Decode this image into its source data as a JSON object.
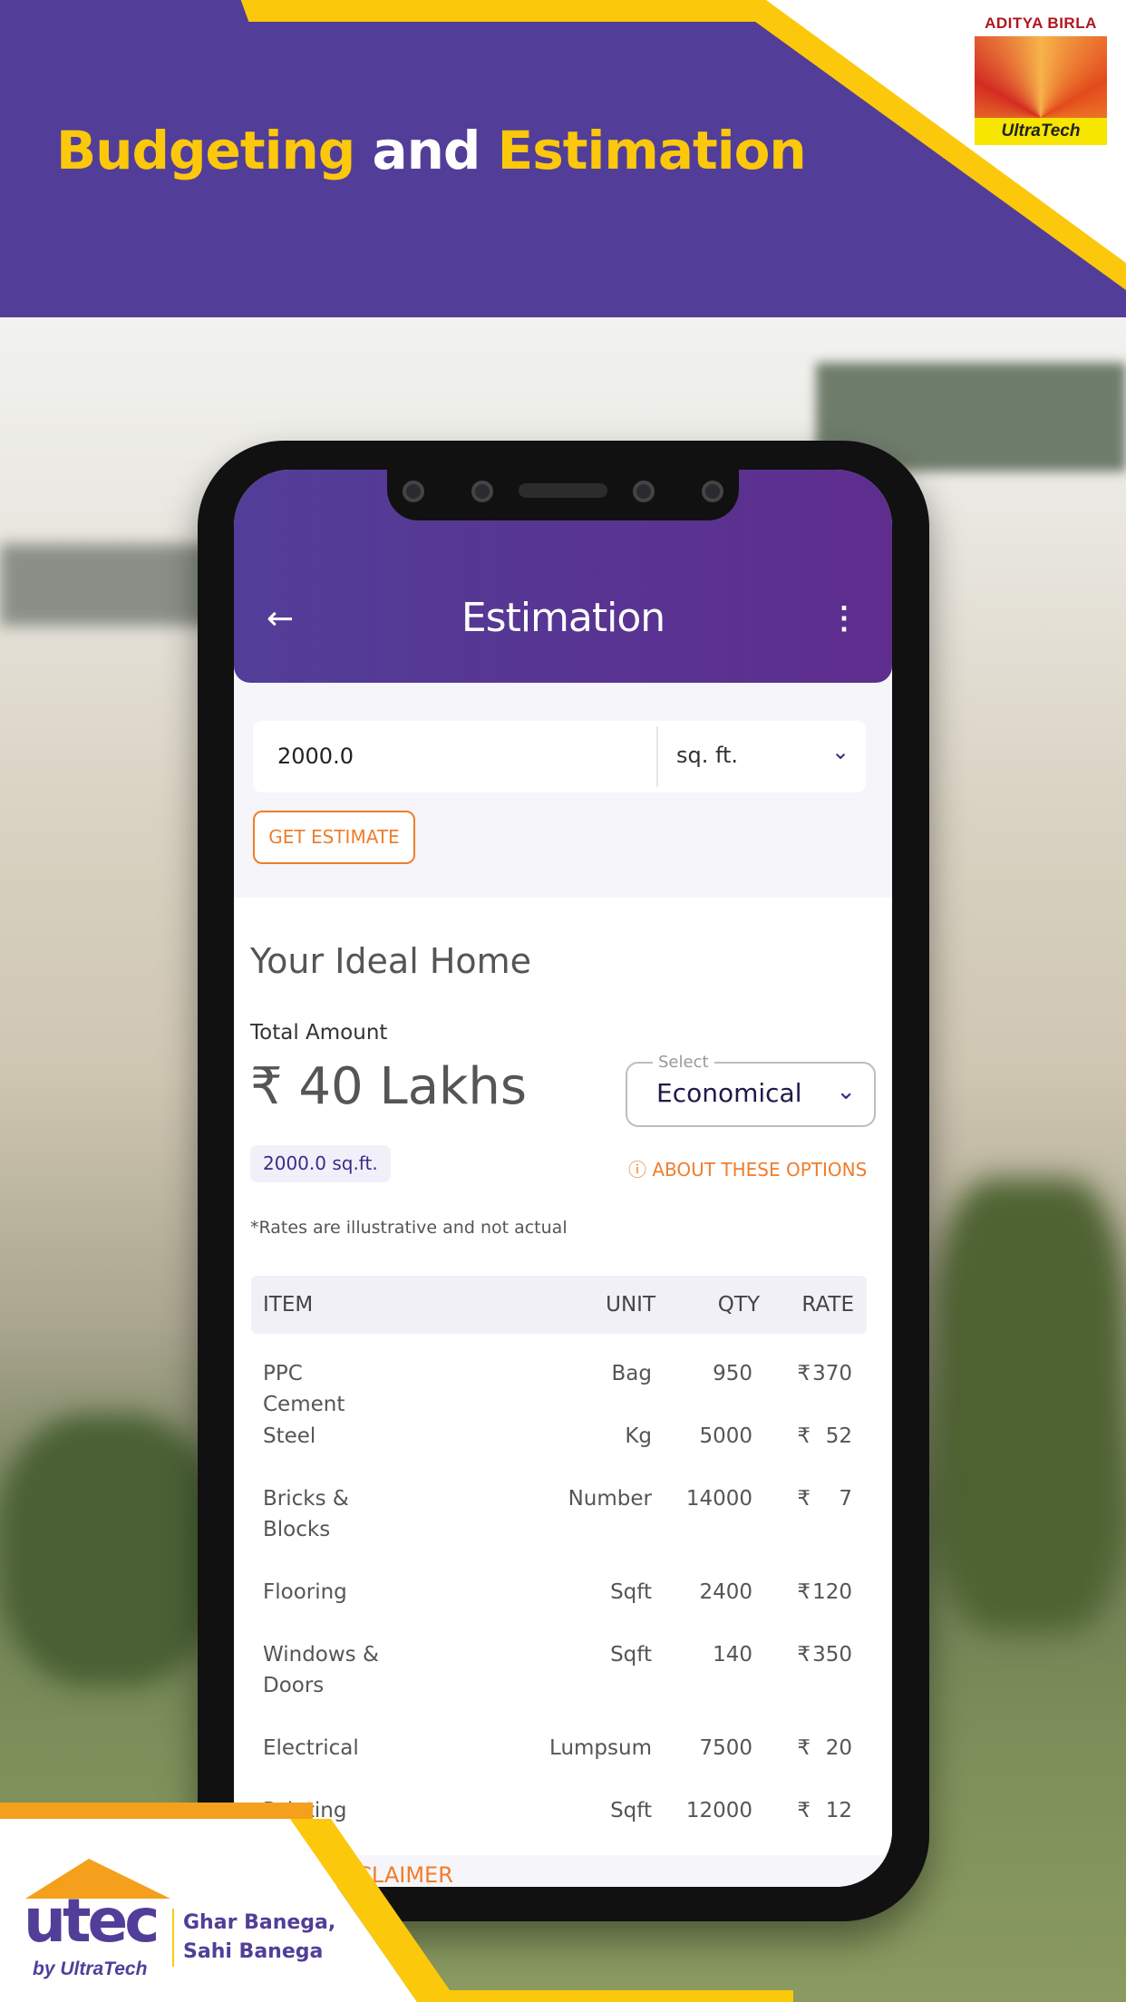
{
  "banner": {
    "title_part1": "Budgeting",
    "title_part2": "and",
    "title_part3": "Estimation",
    "logo_top": "ADITYA BIRLA",
    "logo_bottom": "UltraTech"
  },
  "colors": {
    "brand_purple": "#523e98",
    "brand_yellow": "#fcc80b",
    "accent_orange": "#ef7d2c"
  },
  "app": {
    "title": "Estimation",
    "back_icon": "arrow-left-icon",
    "menu_icon": "more-vertical-icon",
    "area_value": "2000.0",
    "unit_select": "sq. ft.",
    "get_estimate": "GET ESTIMATE",
    "section_title": "Your Ideal Home",
    "total_label": "Total Amount",
    "total_value": "₹ 40 Lakhs",
    "select_label": "Select",
    "select_value": "Economical",
    "area_chip": "2000.0 sq.ft.",
    "about_options": "ABOUT THESE OPTIONS",
    "note": "*Rates are illustrative and not actual",
    "table": {
      "headers": [
        "ITEM",
        "UNIT",
        "QTY",
        "RATE"
      ],
      "rows": [
        {
          "item": "PPC Cement",
          "unit": "Bag",
          "qty": "950",
          "cur": "₹",
          "rate": "370"
        },
        {
          "item": "Steel",
          "unit": "Kg",
          "qty": "5000",
          "cur": "₹",
          "rate": "52"
        },
        {
          "item": "Bricks & Blocks",
          "unit": "Number",
          "qty": "14000",
          "cur": "₹",
          "rate": "7"
        },
        {
          "item": "Flooring",
          "unit": "Sqft",
          "qty": "2400",
          "cur": "₹",
          "rate": "120"
        },
        {
          "item": "Windows & Doors",
          "unit": "Sqft",
          "qty": "140",
          "cur": "₹",
          "rate": "350"
        },
        {
          "item": "Electrical",
          "unit": "Lumpsum",
          "qty": "7500",
          "cur": "₹",
          "rate": "20"
        },
        {
          "item": "Painting",
          "unit": "Sqft",
          "qty": "12000",
          "cur": "₹",
          "rate": "12"
        }
      ]
    },
    "disclaimer": "READ DISCLAIMER"
  },
  "footer": {
    "logo": "utec",
    "logo_by": "by UltraTech",
    "tagline1": "Ghar Banega,",
    "tagline2": "Sahi Banega"
  }
}
